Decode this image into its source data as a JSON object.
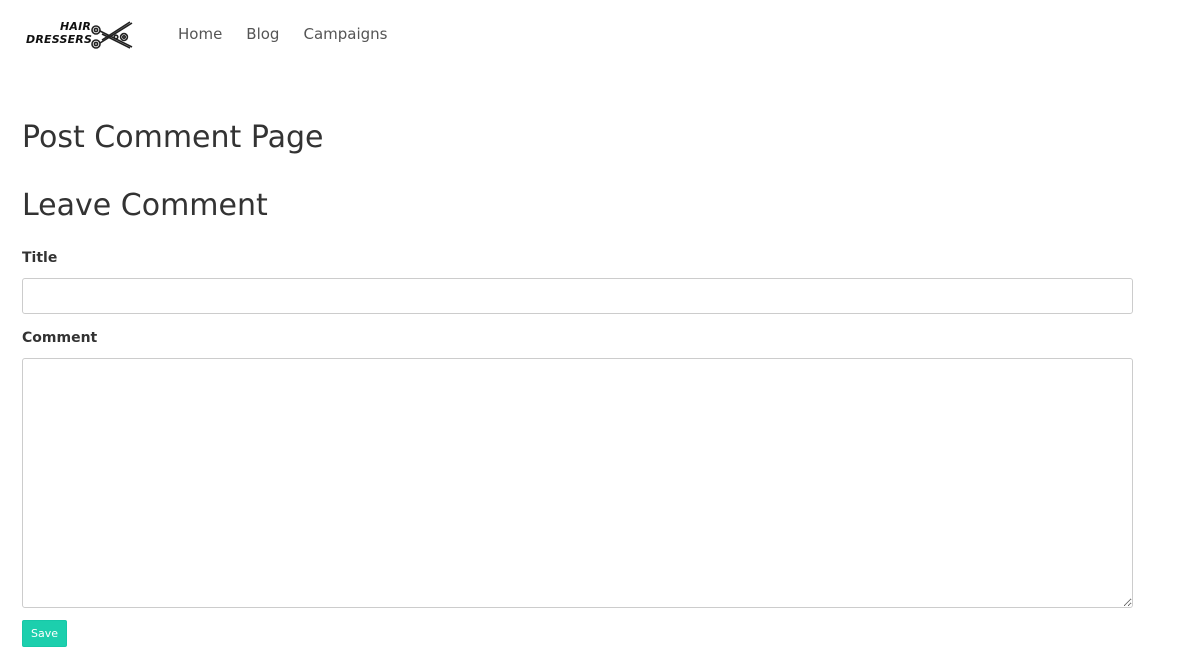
{
  "navbar": {
    "brand": {
      "line1": "HAIR",
      "line2": "DRESSERS",
      "icon": "scissors-icon"
    },
    "links": [
      {
        "label": "Home"
      },
      {
        "label": "Blog"
      },
      {
        "label": "Campaigns"
      }
    ]
  },
  "main": {
    "page_title": "Post Comment Page",
    "section_title": "Leave Comment",
    "form": {
      "title_label": "Title",
      "title_value": "",
      "comment_label": "Comment",
      "comment_value": "",
      "save_label": "Save"
    }
  },
  "colors": {
    "accent": "#1ccfad",
    "text": "#333333",
    "nav_text": "#555555",
    "border": "#cccccc"
  }
}
